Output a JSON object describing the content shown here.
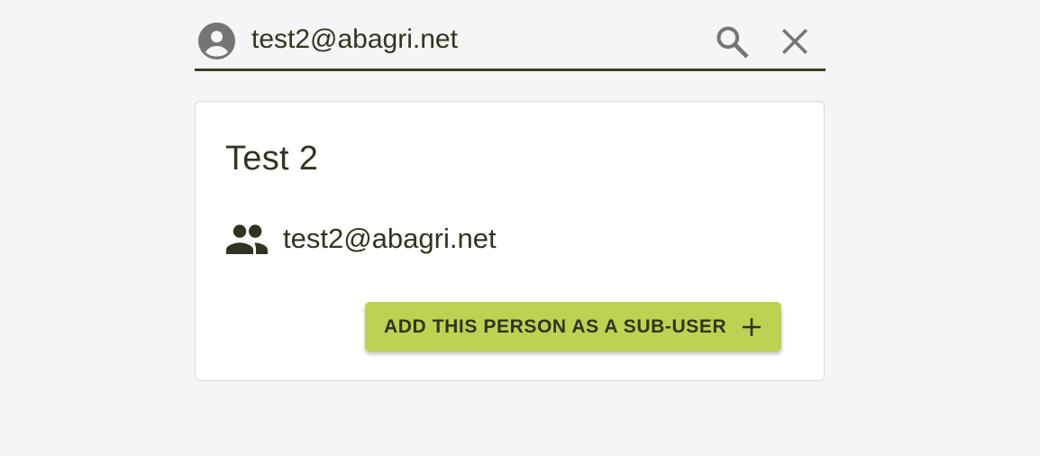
{
  "search": {
    "value": "test2@abagri.net",
    "account_icon": "account-circle-icon",
    "search_icon": "search-icon",
    "clear_icon": "close-icon"
  },
  "result_card": {
    "title": "Test 2",
    "email": "test2@abagri.net",
    "email_icon": "people-icon",
    "add_button_label": "ADD THIS PERSON AS A SUB-USER",
    "add_button_icon": "plus-icon"
  },
  "colors": {
    "background": "#f4f5f7",
    "text_dark": "#2f3520",
    "underline": "#3a4120",
    "button_green": "#bcd253",
    "icon_grey": "#7a7a7a"
  }
}
